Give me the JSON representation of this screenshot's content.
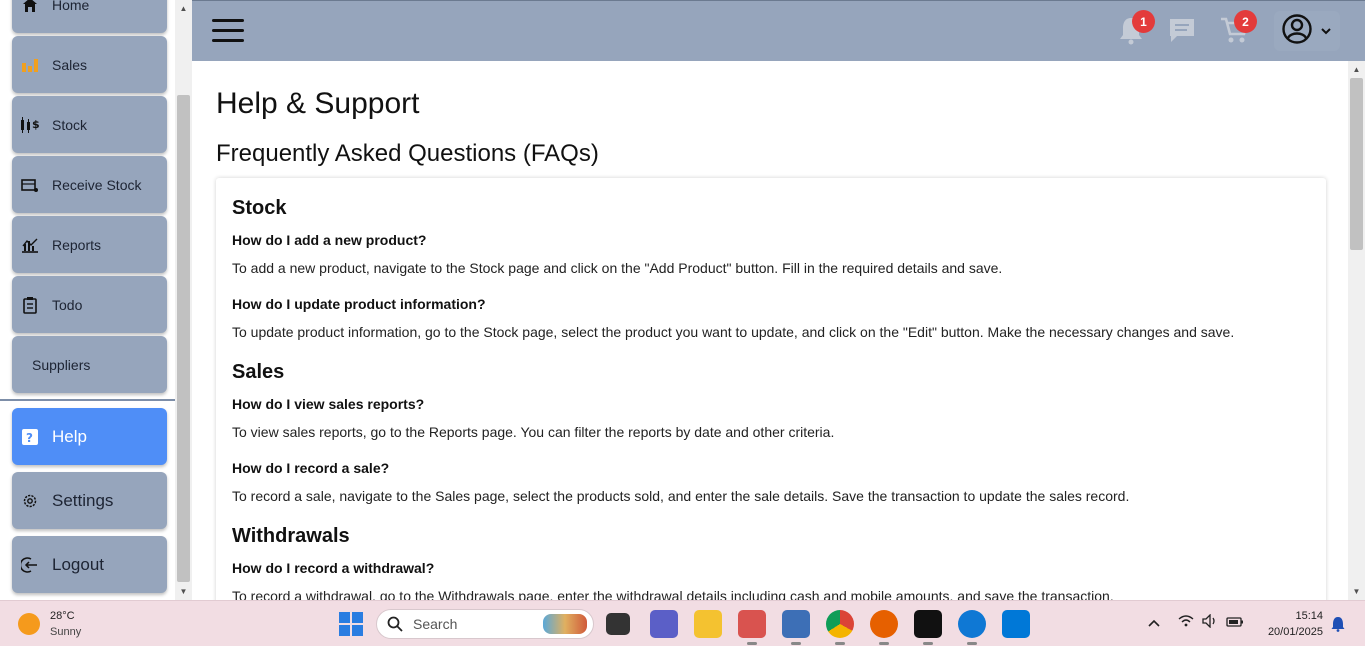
{
  "sidebar": {
    "items": [
      {
        "label": "Home",
        "icon": "home-icon"
      },
      {
        "label": "Sales",
        "icon": "sales-chart-icon"
      },
      {
        "label": "Stock",
        "icon": "stock-icon"
      },
      {
        "label": "Receive Stock",
        "icon": "receive-stock-icon"
      },
      {
        "label": "Reports",
        "icon": "reports-icon"
      },
      {
        "label": "Todo",
        "icon": "clipboard-icon"
      },
      {
        "label": "Suppliers",
        "icon": ""
      }
    ],
    "bottom_items": [
      {
        "label": "Help",
        "icon": "help-icon"
      },
      {
        "label": "Settings",
        "icon": "gear-icon"
      },
      {
        "label": "Logout",
        "icon": "logout-icon"
      }
    ]
  },
  "header": {
    "notifications_count": "1",
    "cart_count": "2"
  },
  "main": {
    "page_title": "Help & Support",
    "faq_title": "Frequently Asked Questions (FAQs)",
    "sections": [
      {
        "title": "Stock",
        "faqs": [
          {
            "q": "How do I add a new product?",
            "a": "To add a new product, navigate to the Stock page and click on the \"Add Product\" button. Fill in the required details and save."
          },
          {
            "q": "How do I update product information?",
            "a": "To update product information, go to the Stock page, select the product you want to update, and click on the \"Edit\" button. Make the necessary changes and save."
          }
        ]
      },
      {
        "title": "Sales",
        "faqs": [
          {
            "q": "How do I view sales reports?",
            "a": "To view sales reports, go to the Reports page. You can filter the reports by date and other criteria."
          },
          {
            "q": "How do I record a sale?",
            "a": "To record a sale, navigate to the Sales page, select the products sold, and enter the sale details. Save the transaction to update the sales record."
          }
        ]
      },
      {
        "title": "Withdrawals",
        "faqs": [
          {
            "q": "How do I record a withdrawal?",
            "a": "To record a withdrawal, go to the Withdrawals page, enter the withdrawal details including cash and mobile amounts, and save the transaction."
          }
        ]
      }
    ]
  },
  "taskbar": {
    "weather_temp": "28°C",
    "weather_cond": "Sunny",
    "search_placeholder": "Search",
    "time": "15:14",
    "date": "20/01/2025"
  },
  "colors": {
    "header_bg": "#96a5bc",
    "nav_bg": "#96a5bc",
    "active_nav": "#4f8ef7",
    "badge": "#e33b3b",
    "taskbar_bg": "#f2dde3"
  }
}
